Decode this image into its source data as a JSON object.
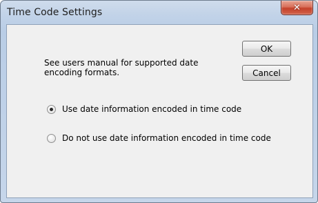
{
  "window": {
    "title": "Time Code Settings",
    "close_glyph": "✕"
  },
  "content": {
    "description": "See users manual for supported date encoding formats.",
    "ok_label": "OK",
    "cancel_label": "Cancel",
    "options": [
      {
        "label": "Use date information encoded in time code",
        "selected": true
      },
      {
        "label": "Do not use date information encoded in time code",
        "selected": false
      }
    ]
  },
  "icons": {
    "close": "close-icon",
    "radio_selected": "radio-selected-icon",
    "radio_unselected": "radio-unselected-icon"
  },
  "colors": {
    "close_button": "#c4412a",
    "frame": "#b9cde6",
    "client_bg": "#f0f0f0"
  }
}
